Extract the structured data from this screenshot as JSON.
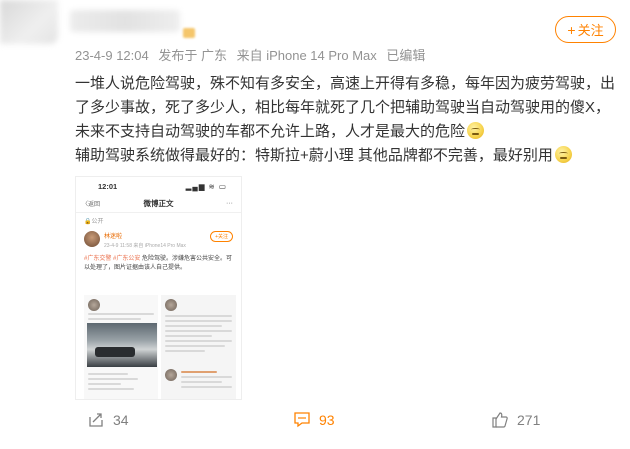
{
  "header": {
    "follow_label": "关注",
    "follow_plus": "+"
  },
  "meta": {
    "date": "23-4-9 12:04",
    "location": "发布于 广东",
    "source": "来自 iPhone 14 Pro Max",
    "edited": "已编辑"
  },
  "post": {
    "line1": "一堆人说危险驾驶，殊不知有多安全，高速上开得有多稳，每年因为疲劳驾驶，出了多少事故，死了多少人，相比每年就死了几个把辅助驾驶当自动驾驶用的傻X，未来不支持自动驾驶的车都不允许上路，人才是最大的危险",
    "line2": "辅助驾驶系统做得最好的：特斯拉+蔚小理   其他品牌都不完善，最好别用"
  },
  "screenshot": {
    "time": "12:01",
    "signal": "▂▄▆ ≋ ▭",
    "back": "〈返回",
    "title": "微博正文",
    "more": "···",
    "public": "🔒公开",
    "author": "林迷啦",
    "author_sub": "23-4-9 11:58 来自 iPhone14 Pro Max",
    "follow": "+关注",
    "body_hl": "#广东交警 #广东公安",
    "body": "危险驾驶。涉嫌危害公共安全。可以处理了，图片证据由该人自己提供。",
    "reply_name": "文责自小明Lite",
    "reply_text": "有人说辅助驾驶诱导说辅助驾驶开车 安全"
  },
  "actions": {
    "repost_count": "34",
    "comment_count": "93",
    "like_count": "271"
  },
  "colors": {
    "accent": "#ff8200",
    "meta_gray": "#939393",
    "text": "#333333"
  }
}
